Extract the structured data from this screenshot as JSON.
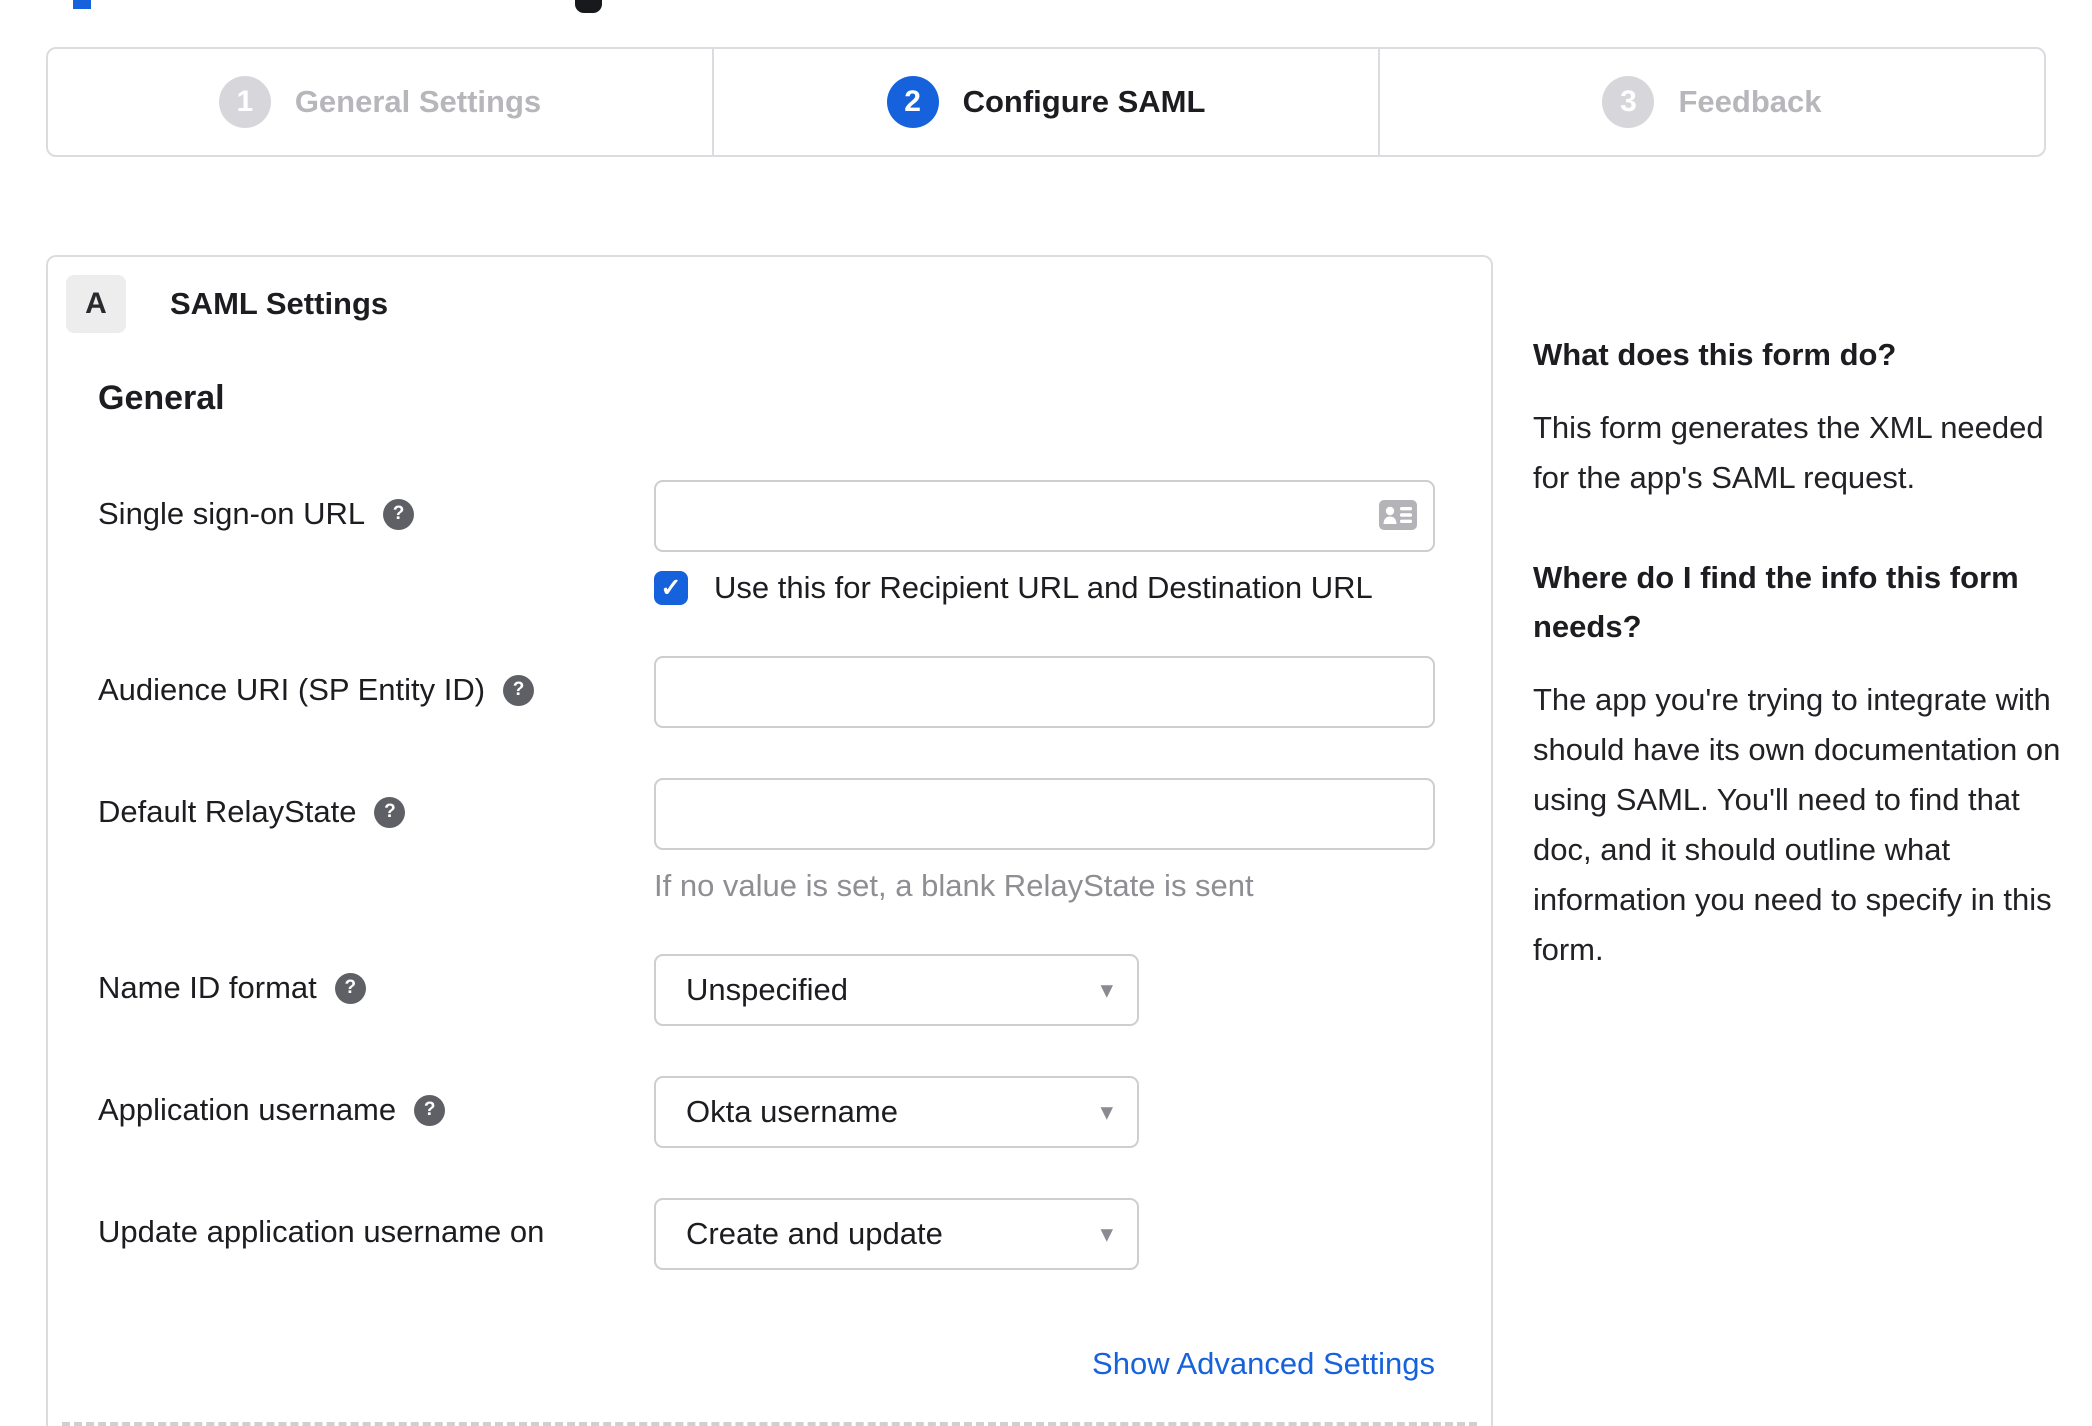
{
  "icons": {
    "help": "?",
    "check": "✓",
    "caret": "▾"
  },
  "colors": {
    "accent_blue": "#1662dd",
    "inactive_gray": "#d7d7db",
    "border_gray": "#dcdce0",
    "text_dark": "#1d1d21",
    "muted_gray": "#8e8e93",
    "link_blue": "#1662dd"
  },
  "stepper": {
    "steps": [
      {
        "number": "1",
        "label": "General Settings",
        "state": "inactive"
      },
      {
        "number": "2",
        "label": "Configure SAML",
        "state": "active"
      },
      {
        "number": "3",
        "label": "Feedback",
        "state": "inactive"
      }
    ]
  },
  "panel": {
    "badge": "A",
    "title": "SAML Settings",
    "section_title": "General",
    "fields": [
      {
        "label": "Single sign-on URL",
        "type": "text",
        "has_help": true,
        "value": "",
        "checkbox_checked": true,
        "checkbox_label": "Use this for Recipient URL and Destination URL"
      },
      {
        "label": "Audience URI (SP Entity ID)",
        "type": "text",
        "has_help": true,
        "value": ""
      },
      {
        "label": "Default RelayState",
        "type": "text",
        "has_help": true,
        "value": "",
        "hint": "If no value is set, a blank RelayState is sent"
      },
      {
        "label": "Name ID format",
        "type": "select",
        "has_help": true,
        "value": "Unspecified"
      },
      {
        "label": "Application username",
        "type": "select",
        "has_help": true,
        "value": "Okta username"
      },
      {
        "label": "Update application username on",
        "type": "select",
        "has_help": false,
        "value": "Create and update"
      }
    ],
    "advanced_link": "Show Advanced Settings"
  },
  "sidebar": {
    "sections": [
      {
        "heading": "What does this form do?",
        "body": "This form generates the XML needed for the app's SAML request."
      },
      {
        "heading": "Where do I find the info this form needs?",
        "body": "The app you're trying to integrate with should have its own documentation on using SAML. You'll need to find that doc, and it should outline what information you need to specify in this form."
      }
    ]
  }
}
